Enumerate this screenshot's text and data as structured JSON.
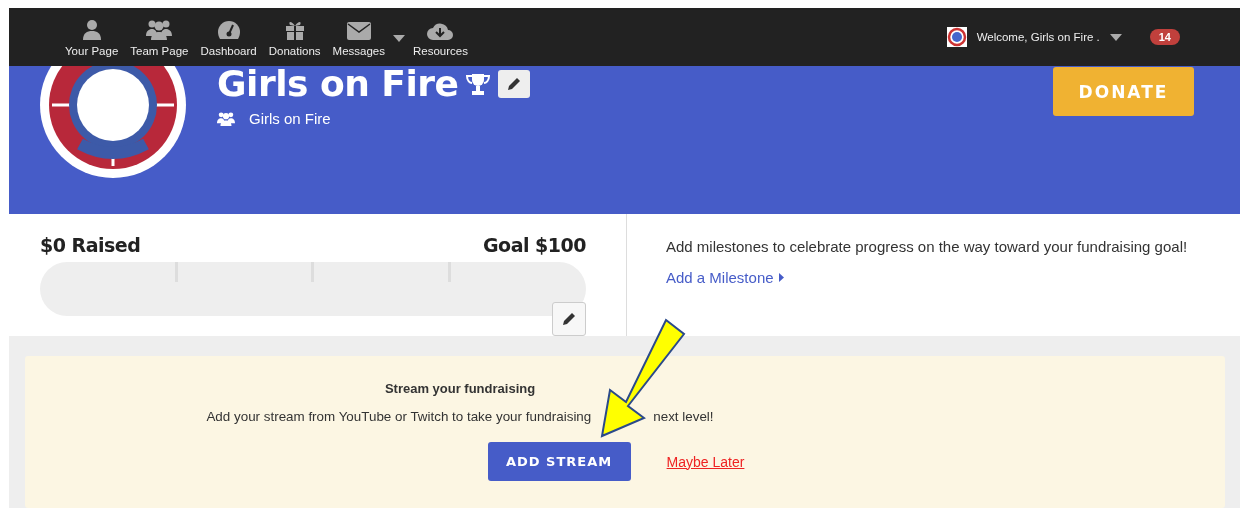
{
  "nav": {
    "items": [
      {
        "label": "Your Page",
        "dropdown": false
      },
      {
        "label": "Team Page",
        "dropdown": false
      },
      {
        "label": "Dashboard",
        "dropdown": false
      },
      {
        "label": "Donations",
        "dropdown": false
      },
      {
        "label": "Messages",
        "dropdown": true
      },
      {
        "label": "Resources",
        "dropdown": false
      }
    ],
    "welcome": "Welcome, Girls on Fire .",
    "badge": "14"
  },
  "hero": {
    "title": "Girls on Fire",
    "team": "Girls on Fire",
    "donate": "DONATE"
  },
  "progress": {
    "raised": "$0 Raised",
    "goal": "Goal $100",
    "level": 0
  },
  "milestones": {
    "text": "Add milestones to celebrate progress on the way toward your fundraising goal!",
    "link": "Add a Milestone"
  },
  "stream": {
    "title": "Stream your fundraising",
    "text_before": "Add your stream from YouTube or Twitch to take your fundraising",
    "text_after": "next level!",
    "button": "ADD STREAM",
    "later": "Maybe Later"
  }
}
